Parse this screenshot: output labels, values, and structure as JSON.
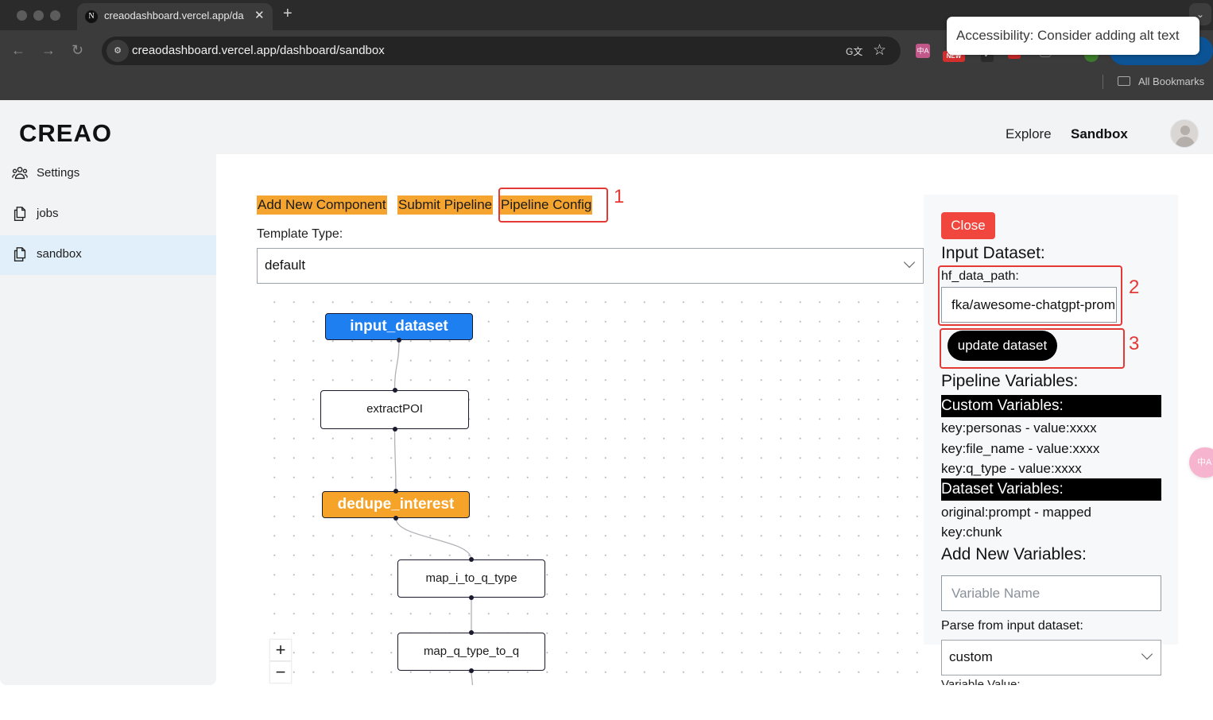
{
  "browser": {
    "tab_title": "creaodashboard.vercel.app/dashboard/sandbox",
    "tab_favicon": "N",
    "url": "creaodashboard.vercel.app/dashboard/sandbox",
    "bookmarks_label": "All Bookmarks",
    "ext_new_badge": "NEW",
    "ext_translate_glyph": "中A",
    "tooltip": "Accessibility: Consider adding alt text",
    "icons": {
      "back": "←",
      "forward": "→",
      "reload": "↻",
      "site_info": "⚙",
      "translate": "G文",
      "star": "☆",
      "close": "✕",
      "plus": "+",
      "chevron": "⌄",
      "check": "✓"
    }
  },
  "app": {
    "logo": "CREAO",
    "nav": {
      "explore": "Explore",
      "sandbox": "Sandbox"
    },
    "sidebar": {
      "items": [
        {
          "label": "Settings",
          "icon": "users-icon",
          "active": false
        },
        {
          "label": "jobs",
          "icon": "documents-icon",
          "active": false
        },
        {
          "label": "sandbox",
          "icon": "documents-icon",
          "active": true
        }
      ]
    },
    "toolbar": {
      "add_component": "Add New Component",
      "submit_pipeline": "Submit Pipeline",
      "pipeline_config": "Pipeline Config"
    },
    "template": {
      "label": "Template Type:",
      "selected": "default"
    },
    "pipeline": {
      "nodes": [
        {
          "id": "input_dataset",
          "label": "input_dataset",
          "style": "blue"
        },
        {
          "id": "extractPOI",
          "label": "extractPOI",
          "style": "plain"
        },
        {
          "id": "dedupe_interest",
          "label": "dedupe_interest",
          "style": "orange"
        },
        {
          "id": "map_i_to_q_type",
          "label": "map_i_to_q_type",
          "style": "plain"
        },
        {
          "id": "map_q_type_to_q",
          "label": "map_q_type_to_q",
          "style": "plain"
        }
      ],
      "edges": [
        [
          "input_dataset",
          "extractPOI"
        ],
        [
          "extractPOI",
          "dedupe_interest"
        ],
        [
          "dedupe_interest",
          "map_i_to_q_type"
        ],
        [
          "map_i_to_q_type",
          "map_q_type_to_q"
        ]
      ],
      "zoom_in": "+",
      "zoom_out": "−"
    },
    "config_panel": {
      "close": "Close",
      "input_dataset_heading": "Input Dataset:",
      "hf_label": "hf_data_path:",
      "hf_value": "fka/awesome-chatgpt-prompts",
      "update_button": "update dataset",
      "pipeline_vars_heading": "Pipeline Variables:",
      "custom_vars_heading": "Custom Variables:",
      "custom_vars": [
        "key:personas - value:xxxx",
        "key:file_name - value:xxxx",
        "key:q_type - value:xxxx"
      ],
      "dataset_vars_heading": "Dataset Variables:",
      "dataset_vars": [
        "original:prompt - mapped",
        "key:chunk"
      ],
      "add_vars_heading": "Add New Variables:",
      "var_name_placeholder": "Variable Name",
      "parse_label": "Parse from input dataset:",
      "parse_selected": "custom",
      "variable_value_label": "Variable Value:"
    },
    "annotations": [
      "1",
      "2",
      "3"
    ],
    "colors": {
      "accent_orange": "#f5a430",
      "node_blue": "#1d7ff0",
      "close_red": "#f0463e",
      "annotation_red": "#e53935",
      "active_sidebar": "#e0effa"
    }
  }
}
